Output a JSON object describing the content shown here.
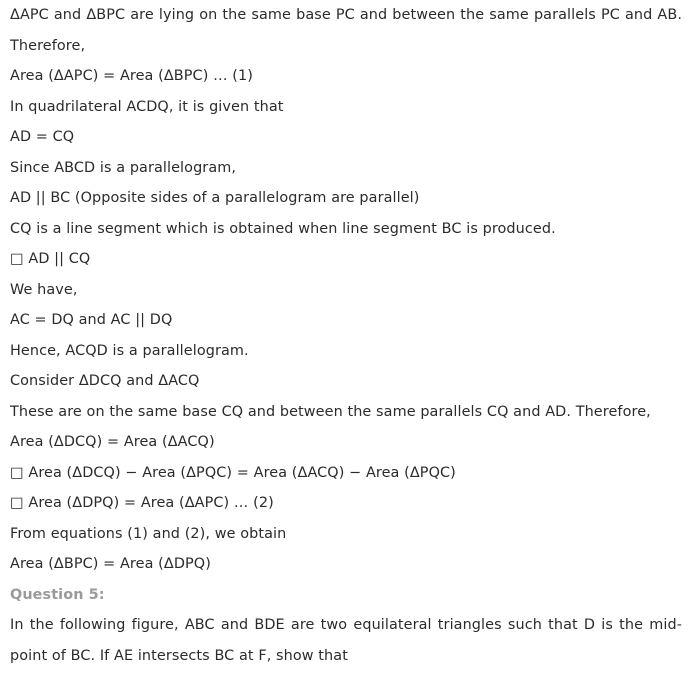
{
  "document": {
    "background_color": "#ffffff",
    "body_text_color": "#2b2b2b",
    "heading_color": "#9a9a9a",
    "blocks": [
      {
        "kind": "paragraph-justified",
        "text": "ΔAPC and ΔBPC are lying on the same base PC and between the same parallels PC and AB. Therefore,"
      },
      {
        "kind": "line",
        "text": "Area (ΔAPC) = Area (ΔBPC) … (1)"
      },
      {
        "kind": "line",
        "text": "In quadrilateral ACDQ, it is given that"
      },
      {
        "kind": "line",
        "text": "AD = CQ"
      },
      {
        "kind": "line",
        "text": "Since ABCD is a parallelogram,"
      },
      {
        "kind": "line",
        "text": "AD || BC (Opposite sides of a parallelogram are parallel)"
      },
      {
        "kind": "line",
        "text": "CQ is a line segment which is obtained when line segment BC is produced."
      },
      {
        "kind": "line",
        "text": "□ AD || CQ"
      },
      {
        "kind": "line",
        "text": "We have,"
      },
      {
        "kind": "line",
        "text": "AC = DQ and AC || DQ"
      },
      {
        "kind": "line",
        "text": "Hence, ACQD is a parallelogram."
      },
      {
        "kind": "line",
        "text": "Consider ΔDCQ and ΔACQ"
      },
      {
        "kind": "paragraph-justified",
        "text": "These are on the same base CQ and between the same parallels CQ and AD. Therefore,"
      },
      {
        "kind": "line",
        "text": "Area (ΔDCQ) = Area (ΔACQ)"
      },
      {
        "kind": "line",
        "text": "□ Area (ΔDCQ) − Area (ΔPQC) = Area (ΔACQ) − Area (ΔPQC)"
      },
      {
        "kind": "line",
        "text": "□ Area (ΔDPQ) = Area (ΔAPC) … (2)"
      },
      {
        "kind": "line",
        "text": "From equations (1) and (2), we obtain"
      },
      {
        "kind": "line",
        "text": "Area (ΔBPC) = Area (ΔDPQ)"
      },
      {
        "kind": "heading",
        "text": "Question 5:"
      },
      {
        "kind": "paragraph-justified",
        "text": "In the following figure, ABC and BDE are two equilateral triangles such that D is the mid-point of BC. If AE intersects BC at F, show that"
      }
    ]
  }
}
